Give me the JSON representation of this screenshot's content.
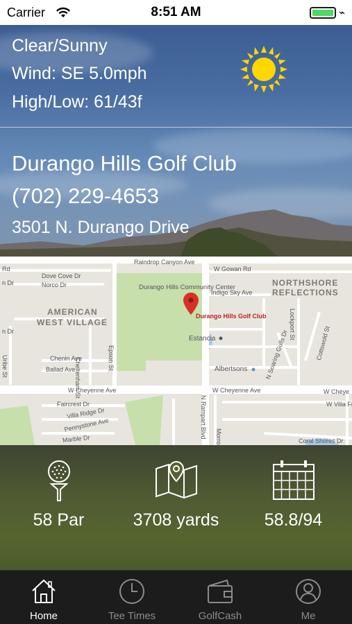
{
  "status_bar": {
    "carrier": "Carrier",
    "time": "8:51 AM",
    "battery_color": "#4cd964"
  },
  "weather": {
    "condition": "Clear/Sunny",
    "wind": "Wind: SE 5.0mph",
    "high_low": "High/Low: 61/43f",
    "icon": "sun-icon",
    "sun_color": "#ffd700"
  },
  "club": {
    "name": "Durango Hills Golf Club",
    "phone": "(702) 229-4653",
    "address": "3501 N. Durango Drive"
  },
  "map": {
    "streets": {
      "raindrop_canyon": "Raindrop Canyon Ave",
      "gowan": "W Gowan Rd",
      "dove_cove": "Dove Cove Dr",
      "norco": "Norco Dr",
      "indigo_sky": "Indigo Sky Ave",
      "chenin": "Chenin Ave",
      "ballad": "Ballad Ave",
      "cheltenham": "Cheltenham St",
      "epson": "Epson St",
      "uribe": "Uribe St",
      "cheyenne_left": "W Cheyenne Ave",
      "cheyenne_right": "W Cheyenne Ave",
      "cheyenne_far": "W Cheye",
      "faircrest": "Faircrest Dr",
      "villa_ridge": "Villa Ridge Dr",
      "pennystone": "Pennystone Ave",
      "marble": "Marble Dr",
      "n_rampart": "N Rampart Blvd",
      "morro": "Morro",
      "n_soaring_gulls": "N Soaring Gulls Dr",
      "lockport": "Lockport St",
      "cottswold": "Cottswold St",
      "villa_fin": "W Villa Fi",
      "coral_shores": "Coral Shores Dr",
      "rd_left": "Rd",
      "rd_left2": "n Dr",
      "rd_left3": "n Dr"
    },
    "places": {
      "community_center": "Durango Hills Community Center",
      "estancia": "Estancia",
      "albertsons": "Albertsons"
    },
    "areas": {
      "american_west_1": "AMERICAN",
      "american_west_2": "WEST VILLAGE",
      "northshore_1": "NORTHSHORE",
      "northshore_2": "REFLECTIONS"
    },
    "pin_label": "Durango Hills Golf Club",
    "pin_color": "#d93025",
    "park_color": "#c6dfab",
    "water_color": "#a9c8e8"
  },
  "stats": [
    {
      "icon": "golf-ball-on-tee-icon",
      "value": "58 Par"
    },
    {
      "icon": "map-pin-icon",
      "value": "3708 yards"
    },
    {
      "icon": "calendar-icon",
      "value": "58.8/94"
    }
  ],
  "tabs": [
    {
      "icon": "home-icon",
      "label": "Home",
      "active": true
    },
    {
      "icon": "clock-icon",
      "label": "Tee Times",
      "active": false
    },
    {
      "icon": "wallet-icon",
      "label": "GolfCash",
      "active": false
    },
    {
      "icon": "person-icon",
      "label": "Me",
      "active": false
    }
  ]
}
